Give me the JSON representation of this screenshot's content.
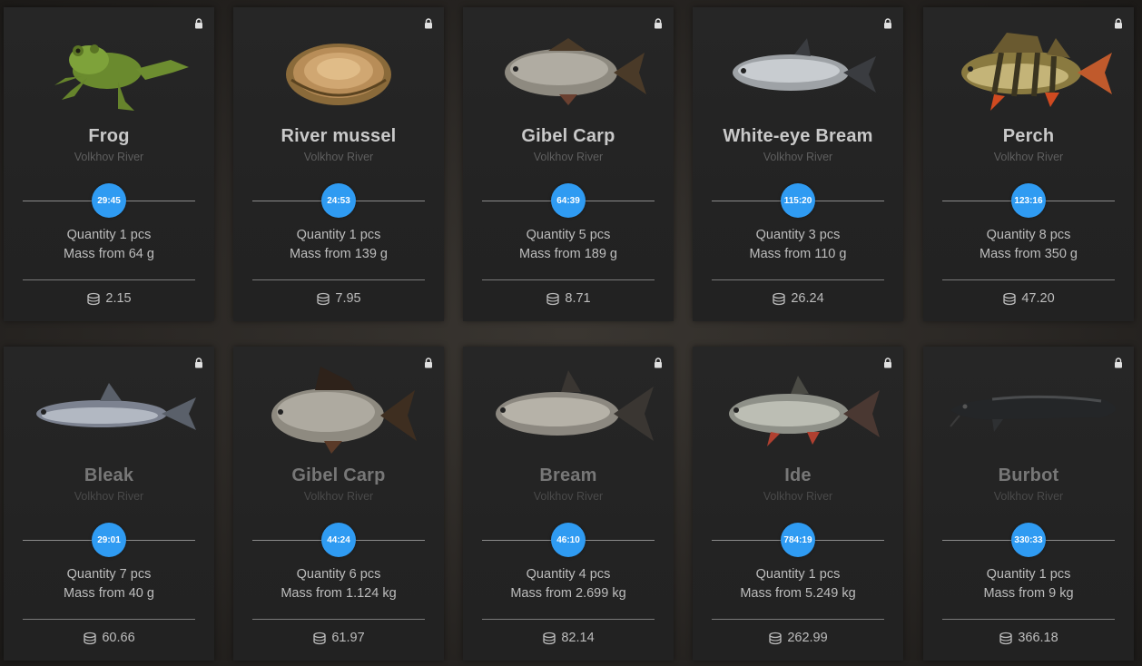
{
  "cards": [
    {
      "name": "Frog",
      "location": "Volkhov River",
      "timer": "29:45",
      "quantity": "Quantity 1 pcs",
      "mass": "Mass from 64 g",
      "price": "2.15",
      "art": "frog"
    },
    {
      "name": "River mussel",
      "location": "Volkhov River",
      "timer": "24:53",
      "quantity": "Quantity 1 pcs",
      "mass": "Mass from 139 g",
      "price": "7.95",
      "art": "mussel"
    },
    {
      "name": "Gibel Carp",
      "location": "Volkhov River",
      "timer": "64:39",
      "quantity": "Quantity 5 pcs",
      "mass": "Mass from 189 g",
      "price": "8.71",
      "art": "carp"
    },
    {
      "name": "White-eye Bream",
      "location": "Volkhov River",
      "timer": "115:20",
      "quantity": "Quantity 3 pcs",
      "mass": "Mass from 110 g",
      "price": "26.24",
      "art": "bream-white"
    },
    {
      "name": "Perch",
      "location": "Volkhov River",
      "timer": "123:16",
      "quantity": "Quantity 8 pcs",
      "mass": "Mass from 350 g",
      "price": "47.20",
      "art": "perch"
    },
    {
      "name": "Bleak",
      "location": "Volkhov River",
      "timer": "29:01",
      "quantity": "Quantity 7 pcs",
      "mass": "Mass from 40 g",
      "price": "60.66",
      "art": "bleak"
    },
    {
      "name": "Gibel Carp",
      "location": "Volkhov River",
      "timer": "44:24",
      "quantity": "Quantity 6 pcs",
      "mass": "Mass from 1.124 kg",
      "price": "61.97",
      "art": "carp"
    },
    {
      "name": "Bream",
      "location": "Volkhov River",
      "timer": "46:10",
      "quantity": "Quantity 4 pcs",
      "mass": "Mass from 2.699 kg",
      "price": "82.14",
      "art": "bream"
    },
    {
      "name": "Ide",
      "location": "Volkhov River",
      "timer": "784:19",
      "quantity": "Quantity 1 pcs",
      "mass": "Mass from 5.249 kg",
      "price": "262.99",
      "art": "ide"
    },
    {
      "name": "Burbot",
      "location": "Volkhov River",
      "timer": "330:33",
      "quantity": "Quantity 1 pcs",
      "mass": "Mass from 9 kg",
      "price": "366.18",
      "art": "burbot"
    }
  ],
  "colors": {
    "timer_badge": "#2f9bf2",
    "card_bg": "#242424",
    "text": "#bdbdbd"
  },
  "icons": {
    "lock": "lock-icon",
    "currency": "coin-stack-icon"
  }
}
